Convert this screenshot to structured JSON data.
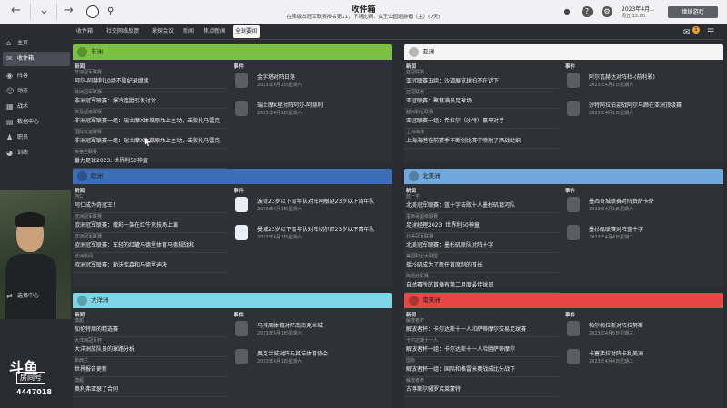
{
  "topbar": {
    "title": "收件箱",
    "subtitle": "在降级出冠军联赛排名第21，下场比赛：女王公园巡游者（主）(7天)",
    "date": "2023年4月...",
    "time": "周五 13:00",
    "continue_label": "继续游戏",
    "back_icon": "back-arrow-icon",
    "forward_icon": "forward-arrow-icon"
  },
  "sidebar": {
    "items": [
      {
        "label": "主页",
        "icon": "home-icon"
      },
      {
        "label": "收件箱",
        "icon": "inbox-icon"
      },
      {
        "label": "阵容",
        "icon": "squad-icon"
      },
      {
        "label": "动态",
        "icon": "dynamics-icon"
      },
      {
        "label": "战术",
        "icon": "tactics-icon"
      },
      {
        "label": "数据中心",
        "icon": "data-hub-icon"
      },
      {
        "label": "职员",
        "icon": "staff-icon"
      },
      {
        "label": "训练",
        "icon": "training-icon"
      },
      {
        "label": "选择中心",
        "icon": "transfer-icon"
      }
    ],
    "watermark": {
      "logo": "斗鱼",
      "room": "房间号",
      "number": "4447018"
    }
  },
  "tabs": [
    "收件箱",
    "社交网络反馈",
    "球探会议",
    "新闻",
    "焦点新闻",
    "全球要闻"
  ],
  "active_tab": 5,
  "columns": {
    "news": "新闻",
    "events": "事件"
  },
  "panels": [
    {
      "title": "非洲",
      "color": "#7bc043",
      "news": [
        {
          "cat": "非洲冠军联赛",
          "title": "阿尔-阿赫利10场不败纪录继续"
        },
        {
          "cat": "非洲冠军联赛",
          "title": "非洲冠军联赛：爆冷连胜引发讨论"
        },
        {
          "cat": "埃及超级联赛",
          "title": "非洲冠军联赛一组：瑞士摩X体草原场上主动，击败扎马雷克"
        },
        {
          "cat": "国际友谊联赛",
          "title": "非洲冠军联赛一组：瑞士摩X体草原场上主动，击败扎马雷克"
        },
        {
          "cat": "英格兰联赛",
          "title": "番力足球2023: 世界利50神童"
        }
      ],
      "events": [
        {
          "title": "金字塔对阵日落",
          "date": "2023年4月1日星期六",
          "icon": "trophy-icon"
        },
        {
          "title": "瑞士摩X星对阵阿尔-阿赫利",
          "date": "2023年4月1日星期六",
          "icon": "trophy-icon"
        }
      ]
    },
    {
      "title": "亚洲",
      "color": "#f5f5f5",
      "news": [
        {
          "cat": "亚冠联赛",
          "title": "亚冠联赛五组：沙迦展览球拍不在话下"
        },
        {
          "cat": "亚冠联赛",
          "title": "亚冠联赛：聚焦满员足球场"
        },
        {
          "cat": "越南职业联赛",
          "title": "亚冠联赛一组：希拉尔（沙特）赢平对手"
        },
        {
          "cat": "上海海港",
          "title": "上海海港在前赛季不断创比赛中喷射了两战组织"
        }
      ],
      "events": [
        {
          "title": "阿尔瓦赫达对阵杜-(前利雅)",
          "date": "2023年4月1日星期六",
          "icon": "club-crest-icon"
        },
        {
          "title": "沙特阿拉伯迎战阿尔马蹄在亚洲顶级赛",
          "date": "2023年4月1日星期六",
          "icon": "club-crest-icon"
        }
      ]
    },
    {
      "title": "欧洲",
      "color": "#3a6fb8",
      "news": [
        {
          "cat": "阿仁",
          "title": "阿仁成为奇冠王！"
        },
        {
          "cat": "欧洲冠军联赛",
          "title": "欧洲冠军联赛：撒彩一架在红牛竞技场上演"
        },
        {
          "cat": "欧洲冠军联赛",
          "title": "欧洲冠军联赛：车轻的红罐马德里体育马德规战和"
        },
        {
          "cat": "欧洲新闻",
          "title": "欧洲冠军联赛：勒沃库森和马德里迪决"
        }
      ],
      "events": [
        {
          "title": "波荷23岁以下青年队对阵阿根廷23岁以下青年队",
          "date": "2023年4月1日星期六",
          "icon": "shield-icon"
        },
        {
          "title": "曼城23岁以下青年队对阵切尔西23岁以下青年队",
          "date": "2023年4月1日星期六",
          "icon": "shield-icon"
        }
      ]
    },
    {
      "title": "北美洲",
      "color": "#6fa8dc",
      "news": [
        {
          "cat": "蓝十字",
          "title": "北美冠军联赛：蓝十字击败十人墨杉矶银河队"
        },
        {
          "cat": "墨西哥超级联赛",
          "title": "足球经理2023: 世界利50神童"
        },
        {
          "cat": "北美冠军联赛",
          "title": "北美冠军联赛：墨杉矶联队对阵十字"
        },
        {
          "cat": "美国职业大联盟",
          "title": "摇杉矶成为了新任首席制的首长"
        },
        {
          "cat": "阿根廷联赛",
          "title": "自然赛所的首播有第二月度最佳球员"
        }
      ],
      "events": [
        {
          "title": "墨西哥城联赛对阵费萨卡萨",
          "date": "2023年4月1日星期六",
          "icon": "club-crest-icon"
        },
        {
          "title": "墨杉矶联赛对阵蓝十字",
          "date": "2023年4月4日星期二",
          "icon": "club-crest-icon"
        }
      ]
    },
    {
      "title": "大洋洲",
      "color": "#7fd4e6",
      "news": [
        {
          "cat": "澳超",
          "title": "加伦特周的精选赛"
        },
        {
          "cat": "大洋洲冠军杯",
          "title": "大洋洲族队员的球路分析"
        },
        {
          "cat": "新西兰",
          "title": "世界报告更新"
        },
        {
          "cat": "澳超",
          "title": "奥利弗亚瑟了合同"
        }
      ],
      "events": [
        {
          "title": "马其周体育对阵南南克兰城",
          "date": "2023年4月1日星期六",
          "icon": "ball-icon"
        },
        {
          "title": "奥克兰城对阵马其诺体育协会",
          "date": "2023年4月1日星期六",
          "icon": "ball-icon"
        }
      ]
    },
    {
      "title": "南美洲",
      "color": "#e84545",
      "news": [
        {
          "cat": "解放者杯",
          "title": "解放者杯：卡尔达斯十一人和萨蒂摩尔交易足球赛"
        },
        {
          "cat": "卡尔达斯十一人",
          "title": "解放者杯一组：卡尔达斯十一人险胜萨蒂摩尔"
        },
        {
          "cat": "国际",
          "title": "解放者杯一组：国际和格雷米奥战成比分战下"
        },
        {
          "cat": "解放者杯",
          "title": "古尊斯尔骚罗克莱蒙特"
        }
      ],
      "events": [
        {
          "title": "帕尔梅拉斯对阵拉努斯",
          "date": "2023年4月5日星期三",
          "icon": "trophy-icon"
        },
        {
          "title": "卡塞弗拉对阵卡利美洲",
          "date": "2023年4月4日星期二",
          "icon": "trophy-icon"
        }
      ]
    }
  ]
}
